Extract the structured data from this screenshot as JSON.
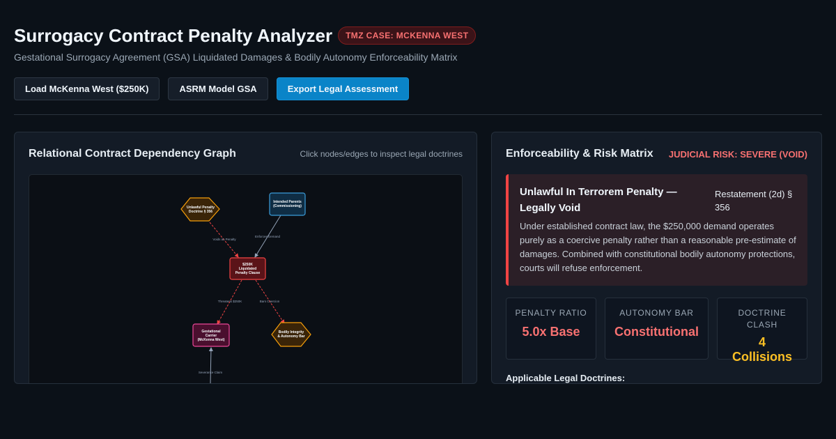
{
  "header": {
    "title": "Surrogacy Contract Penalty Analyzer",
    "case_badge": "TMZ CASE: MCKENNA WEST",
    "subtitle": "Gestational Surrogacy Agreement (GSA) Liquidated Damages & Bodily Autonomy Enforceability Matrix"
  },
  "toolbar": {
    "load_label": "Load McKenna West ($250K)",
    "asrm_label": "ASRM Model GSA",
    "export_label": "Export Legal Assessment"
  },
  "graph_panel": {
    "title": "Relational Contract Dependency Graph",
    "hint": "Click nodes/edges to inspect legal doctrines",
    "nodes": {
      "penalty_doctrine": [
        "Unlawful Penalty",
        "Doctrine § 356"
      ],
      "intended_parents": [
        "Intended Parents",
        "(Commissioning)"
      ],
      "clause": [
        "$250K",
        "Liquidated",
        "Penalty Clause"
      ],
      "carrier": [
        "Gestational",
        "Carrier",
        "(McKenna West)"
      ],
      "bodily": [
        "Bodily Integrity",
        "& Autonomy Bar"
      ]
    },
    "edges": {
      "voids": "Voids as Penalty",
      "enforces": "Enforces Demand",
      "threatens": "Threatens $250K",
      "bars": "Bars Coercion",
      "severance": "Severance Claim"
    }
  },
  "risk_panel": {
    "title": "Enforceability & Risk Matrix",
    "judicial_risk": "JUDICIAL RISK: SEVERE (VOID)",
    "alert": {
      "title": "Unlawful In Terrorem Penalty — Legally Void",
      "reference": "Restatement (2d) § 356",
      "body": "Under established contract law, the $250,000 demand operates purely as a coercive penalty rather than a reasonable pre-estimate of damages. Combined with constitutional bodily autonomy protections, courts will refuse enforcement."
    },
    "stats": [
      {
        "label": "PENALTY RATIO",
        "value": "5.0x Base",
        "color": "#f87171"
      },
      {
        "label": "AUTONOMY BAR",
        "value": "Constitutional",
        "color": "#f87171"
      },
      {
        "label": "DOCTRINE CLASH",
        "value": "4 Collisions",
        "color": "#fbbf24"
      }
    ],
    "doctrines_label": "Applicable Legal Doctrines:"
  },
  "colors": {
    "danger": "#f87171",
    "warning": "#fbbf24",
    "accent": "#0a84c8"
  }
}
